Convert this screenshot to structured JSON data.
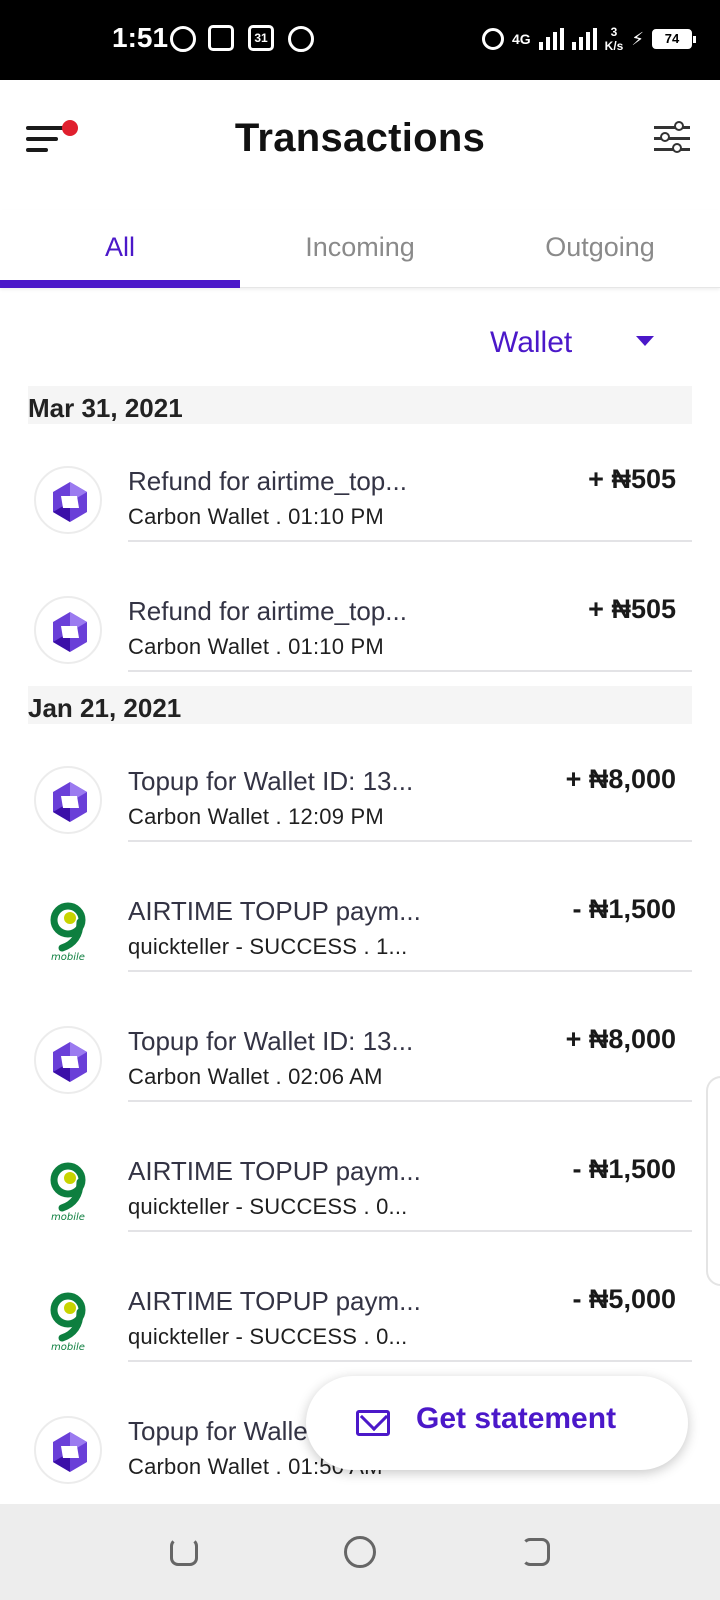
{
  "status_bar": {
    "time": "1:51",
    "calendar_day": "31",
    "network": "4G",
    "speed_value": "3",
    "speed_unit": "K/s",
    "battery": "74"
  },
  "header": {
    "title": "Transactions"
  },
  "tabs": [
    {
      "label": "All",
      "active": true
    },
    {
      "label": "Incoming",
      "active": false
    },
    {
      "label": "Outgoing",
      "active": false
    }
  ],
  "wallet_filter": {
    "selected": "Wallet"
  },
  "groups": [
    {
      "date": "Mar 31, 2021",
      "transactions": [
        {
          "icon": "carbon-logo-icon",
          "title": "Refund for airtime_top...",
          "subtitle": "Carbon Wallet . 01:10 PM",
          "amount": "+ ₦505"
        },
        {
          "icon": "carbon-logo-icon",
          "title": "Refund for airtime_top...",
          "subtitle": "Carbon Wallet . 01:10 PM",
          "amount": "+ ₦505"
        }
      ]
    },
    {
      "date": "Jan 21, 2021",
      "transactions": [
        {
          "icon": "carbon-logo-icon",
          "title": "Topup for Wallet ID: 13...",
          "subtitle": "Carbon Wallet . 12:09 PM",
          "amount": "+ ₦8,000"
        },
        {
          "icon": "9mobile-logo-icon",
          "title": "AIRTIME TOPUP paym...",
          "subtitle": "quickteller - SUCCESS . 1...",
          "amount": "- ₦1,500"
        },
        {
          "icon": "carbon-logo-icon",
          "title": "Topup for Wallet ID: 13...",
          "subtitle": "Carbon Wallet . 02:06 AM",
          "amount": "+ ₦8,000"
        },
        {
          "icon": "9mobile-logo-icon",
          "title": "AIRTIME TOPUP paym...",
          "subtitle": "quickteller - SUCCESS . 0...",
          "amount": "- ₦1,500"
        },
        {
          "icon": "9mobile-logo-icon",
          "title": "AIRTIME TOPUP paym...",
          "subtitle": "quickteller - SUCCESS . 0...",
          "amount": "- ₦5,000"
        },
        {
          "icon": "carbon-logo-icon",
          "title": "Topup for Walle",
          "subtitle": "Carbon Wallet . 01:50 AM",
          "amount": ""
        }
      ]
    }
  ],
  "fab": {
    "label": "Get statement",
    "icon": "mail-icon"
  },
  "colors": {
    "accent": "#4b18c9",
    "notification_dot": "#e0202e",
    "nine_mobile_green": "#0d7f3f",
    "nine_mobile_yellow": "#c8d400"
  }
}
